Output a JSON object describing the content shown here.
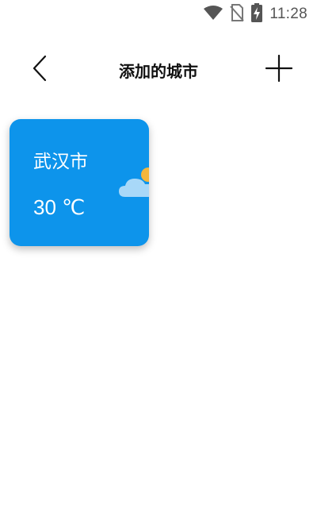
{
  "status_bar": {
    "time": "11:28",
    "icons": [
      "wifi-icon",
      "no-sim-icon",
      "battery-charging-icon"
    ]
  },
  "header": {
    "title": "添加的城市",
    "back_icon": "back-arrow-icon",
    "add_icon": "plus-icon"
  },
  "cities": [
    {
      "name": "武汉市",
      "temperature": "30 ℃",
      "weather_icon": "partly-cloudy-icon",
      "card_color": "#0d94eb"
    }
  ]
}
